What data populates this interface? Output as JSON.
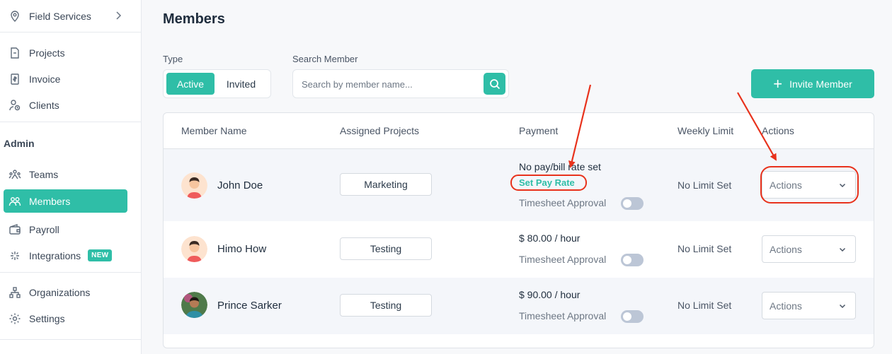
{
  "sidebar": {
    "items_top": [
      {
        "label": "Field Services",
        "icon": "map-pin-icon"
      },
      {
        "label": "Projects",
        "icon": "document-icon"
      },
      {
        "label": "Invoice",
        "icon": "invoice-icon"
      },
      {
        "label": "Clients",
        "icon": "clients-icon"
      }
    ],
    "section_label": "Admin",
    "items_admin": [
      {
        "label": "Teams",
        "icon": "teams-icon"
      },
      {
        "label": "Members",
        "icon": "members-icon",
        "active": true
      },
      {
        "label": "Payroll",
        "icon": "wallet-icon"
      },
      {
        "label": "Integrations",
        "icon": "integrations-icon",
        "badge": "NEW"
      },
      {
        "label": "Organizations",
        "icon": "organizations-icon"
      },
      {
        "label": "Settings",
        "icon": "gear-icon"
      }
    ]
  },
  "main": {
    "title": "Members",
    "type_label": "Type",
    "type_options": [
      "Active",
      "Invited"
    ],
    "search_label": "Search Member",
    "search_placeholder": "Search by member name...",
    "invite_button": "Invite Member"
  },
  "table": {
    "headers": [
      "Member Name",
      "Assigned Projects",
      "Payment",
      "Weekly Limit",
      "Actions"
    ],
    "rows": [
      {
        "name": "John Doe",
        "project": "Marketing",
        "payment": "No pay/bill rate set",
        "set_pay_link": "Set Pay Rate",
        "timesheet": "Timesheet Approval",
        "limit": "No Limit Set",
        "actions": "Actions"
      },
      {
        "name": "Himo How",
        "project": "Testing",
        "payment": "$ 80.00 / hour",
        "timesheet": "Timesheet Approval",
        "limit": "No Limit Set",
        "actions": "Actions"
      },
      {
        "name": "Prince Sarker",
        "project": "Testing",
        "payment": "$ 90.00 / hour",
        "timesheet": "Timesheet Approval",
        "limit": "No Limit Set",
        "actions": "Actions"
      }
    ]
  },
  "colors": {
    "accent": "#2fbea7",
    "annotation": "#e8321c"
  }
}
